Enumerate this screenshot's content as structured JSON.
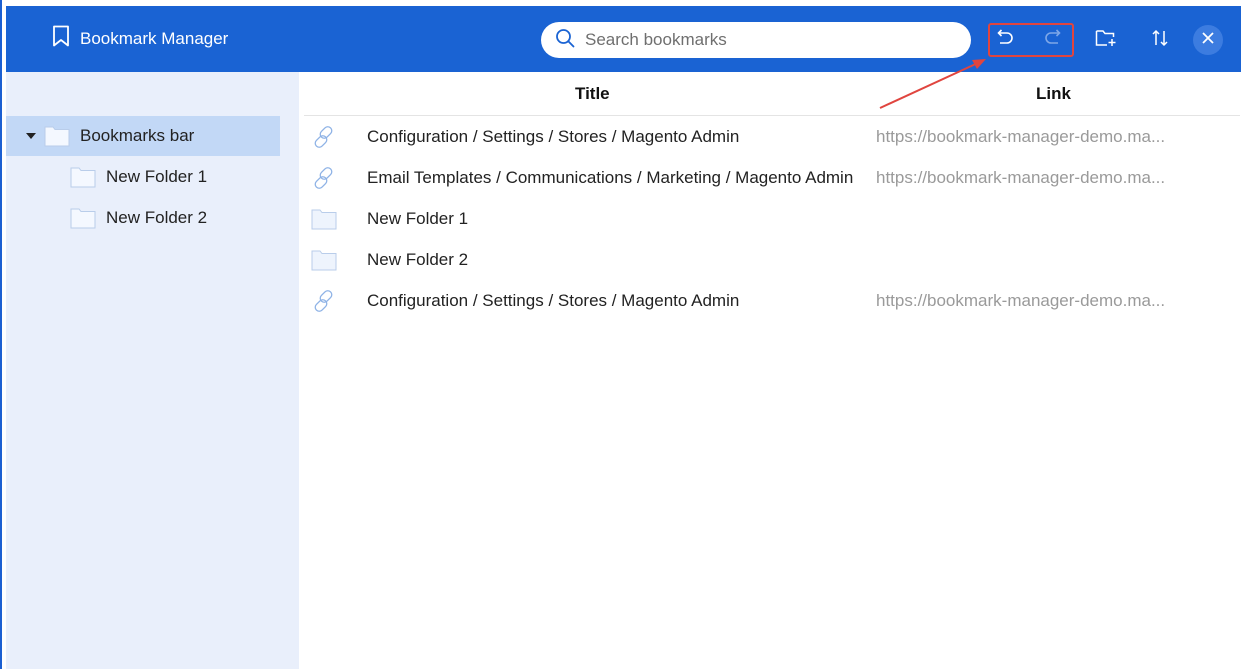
{
  "header": {
    "app_title": "Bookmark Manager",
    "search_placeholder": "Search bookmarks",
    "search_value": "",
    "buttons": {
      "undo": "undo-icon",
      "redo": "redo-icon",
      "new_folder": "new-folder-icon",
      "sort": "sort-icon",
      "close": "close-icon"
    },
    "colors": {
      "header_bg": "#1a63d3",
      "highlight_box": "#e0453f"
    }
  },
  "sidebar": {
    "items": [
      {
        "label": "Bookmarks bar",
        "expanded": true,
        "selected": true
      },
      {
        "label": "New Folder 1"
      },
      {
        "label": "New Folder 2"
      }
    ]
  },
  "table": {
    "columns": [
      "Title",
      "Link"
    ],
    "rows": [
      {
        "type": "link",
        "title": "Configuration / Settings / Stores / Magento Admin",
        "link": "https://bookmark-manager-demo.ma..."
      },
      {
        "type": "link",
        "title": "Email Templates / Communications / Marketing / Magento Admin",
        "link": "https://bookmark-manager-demo.ma..."
      },
      {
        "type": "folder",
        "title": "New Folder 1",
        "link": ""
      },
      {
        "type": "folder",
        "title": "New Folder 2",
        "link": ""
      },
      {
        "type": "link",
        "title": "Configuration / Settings / Stores / Magento Admin",
        "link": "https://bookmark-manager-demo.ma..."
      }
    ]
  }
}
